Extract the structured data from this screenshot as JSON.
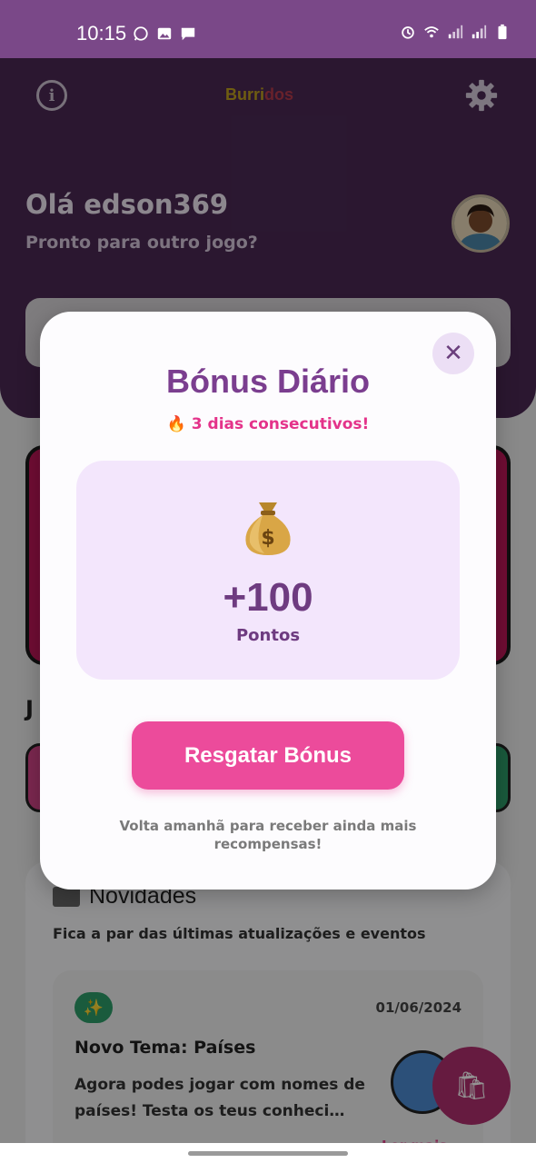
{
  "status_bar": {
    "time": "10:15",
    "left_icons": [
      "whatsapp-icon",
      "image-icon",
      "message-icon"
    ],
    "right_icons": [
      "alarm-icon",
      "wifi-icon",
      "signal-icon",
      "signal-icon",
      "battery-icon"
    ]
  },
  "header": {
    "logo_part1": "Burri",
    "logo_part2": "dos",
    "greeting": "Olá edson369",
    "subtitle": "Pronto para outro jogo?",
    "info_icon": "i"
  },
  "background": {
    "section_partial": "J",
    "news": {
      "title": "Novidades",
      "subtitle": "Fica a par das últimas atualizações e eventos",
      "item": {
        "badge_icon": "✨",
        "date": "01/06/2024",
        "title": "Novo Tema: Países",
        "text": "Agora podes jogar com nomes de países! Testa os teus conheci…",
        "read_more": "Ler mais →"
      }
    },
    "fab_icon": "🛍"
  },
  "modal": {
    "close_icon": "✕",
    "title": "Bónus Diário",
    "streak": "🔥 3 dias consecutivos!",
    "amount": "+100",
    "points_label": "Pontos",
    "claim_button": "Resgatar Bónus",
    "footnote": "Volta amanhã para receber ainda mais recompensas!"
  },
  "colors": {
    "status_bar": "#7a4888",
    "header": "#4a2954",
    "accent_pink": "#ec4b9b",
    "title_purple": "#7b3e8f",
    "bonus_box": "#f3e6fc"
  }
}
